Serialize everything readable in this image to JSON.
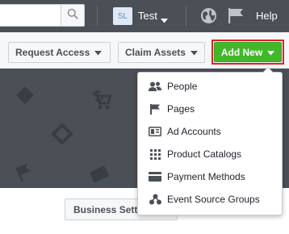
{
  "topbar": {
    "search": {
      "value": "",
      "placeholder": ""
    },
    "account": {
      "initials": "SL",
      "name": "Test"
    },
    "help_label": "Help"
  },
  "toolbar": {
    "request_access_label": "Request Access",
    "claim_assets_label": "Claim Assets",
    "add_new_label": "Add New",
    "accent": "#42b72a",
    "highlight": "#e0202a"
  },
  "panel": {
    "business_settings_label": "Business Sett"
  },
  "add_new_menu": {
    "items": [
      {
        "label": "People",
        "icon": "people-icon"
      },
      {
        "label": "Pages",
        "icon": "flag-icon"
      },
      {
        "label": "Ad Accounts",
        "icon": "ad-account-icon"
      },
      {
        "label": "Product Catalogs",
        "icon": "grid-icon"
      },
      {
        "label": "Payment Methods",
        "icon": "credit-card-icon"
      },
      {
        "label": "Event Source Groups",
        "icon": "event-source-icon"
      }
    ]
  }
}
